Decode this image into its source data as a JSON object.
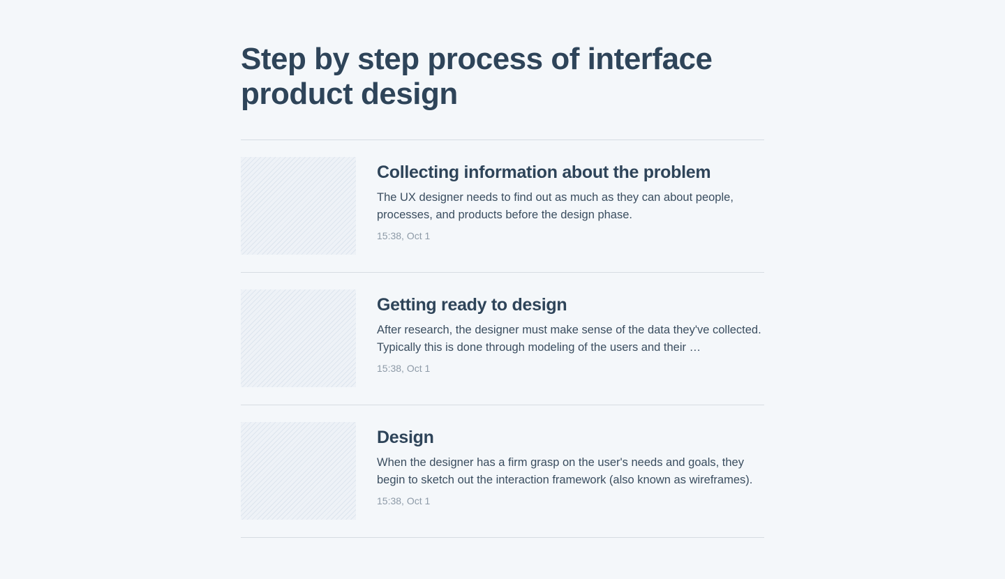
{
  "page": {
    "title": "Step by step process of interface product design"
  },
  "articles": [
    {
      "title": "Collecting information about the problem",
      "description": "The UX designer needs to find out as much as they can about people, processes, and products before the design phase.",
      "time": "15:38, Oct 1"
    },
    {
      "title": "Getting ready to design",
      "description": "After research, the designer must make sense of the data they've collected. Typically this is done through modeling of the users and their …",
      "time": "15:38, Oct 1"
    },
    {
      "title": "Design",
      "description": "When the designer has a firm grasp on the user's needs and goals, they begin to sketch out the interaction framework (also known as wireframes).",
      "time": "15:38, Oct 1"
    }
  ],
  "colors": {
    "background": "#f4f7fa",
    "heading": "#2e4459",
    "body_text": "#3a4d5f",
    "muted_text": "#8d9aa7",
    "divider": "#d6dce2",
    "thumbnail_placeholder": "#eef2f7"
  }
}
